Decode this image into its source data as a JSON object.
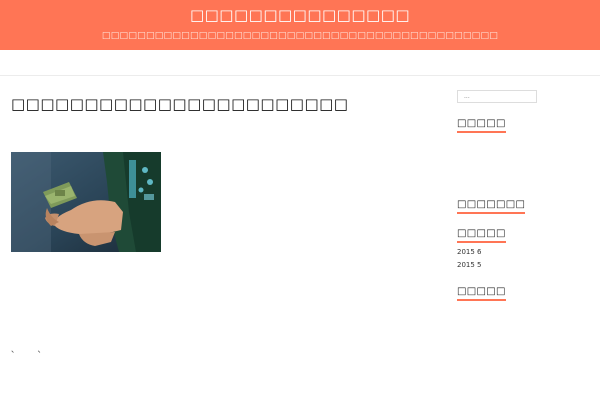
{
  "header": {
    "site_title": "□□□□□□□□□□□□□□□",
    "site_description": "□□□□□□□□□□□□□□□□□□□□□□□□□□□□□□□□□□□□□□□□□□□□□",
    "background_color": "#ff7555"
  },
  "post": {
    "title": "□□□□□□□□□□□□□□□□□□□□□□□",
    "image_icon": "hand-holding-money-photo",
    "footer_text": "、 、"
  },
  "sidebar": {
    "search_placeholder": "...",
    "widgets": [
      {
        "title": "□□□□□"
      },
      {
        "title": "□□□□□□□"
      },
      {
        "title": "□□□□□"
      },
      {
        "title": "□□□□□"
      }
    ],
    "archives": [
      {
        "label": "2015 6"
      },
      {
        "label": "2015 5"
      }
    ],
    "accent_color": "#ff7555"
  }
}
